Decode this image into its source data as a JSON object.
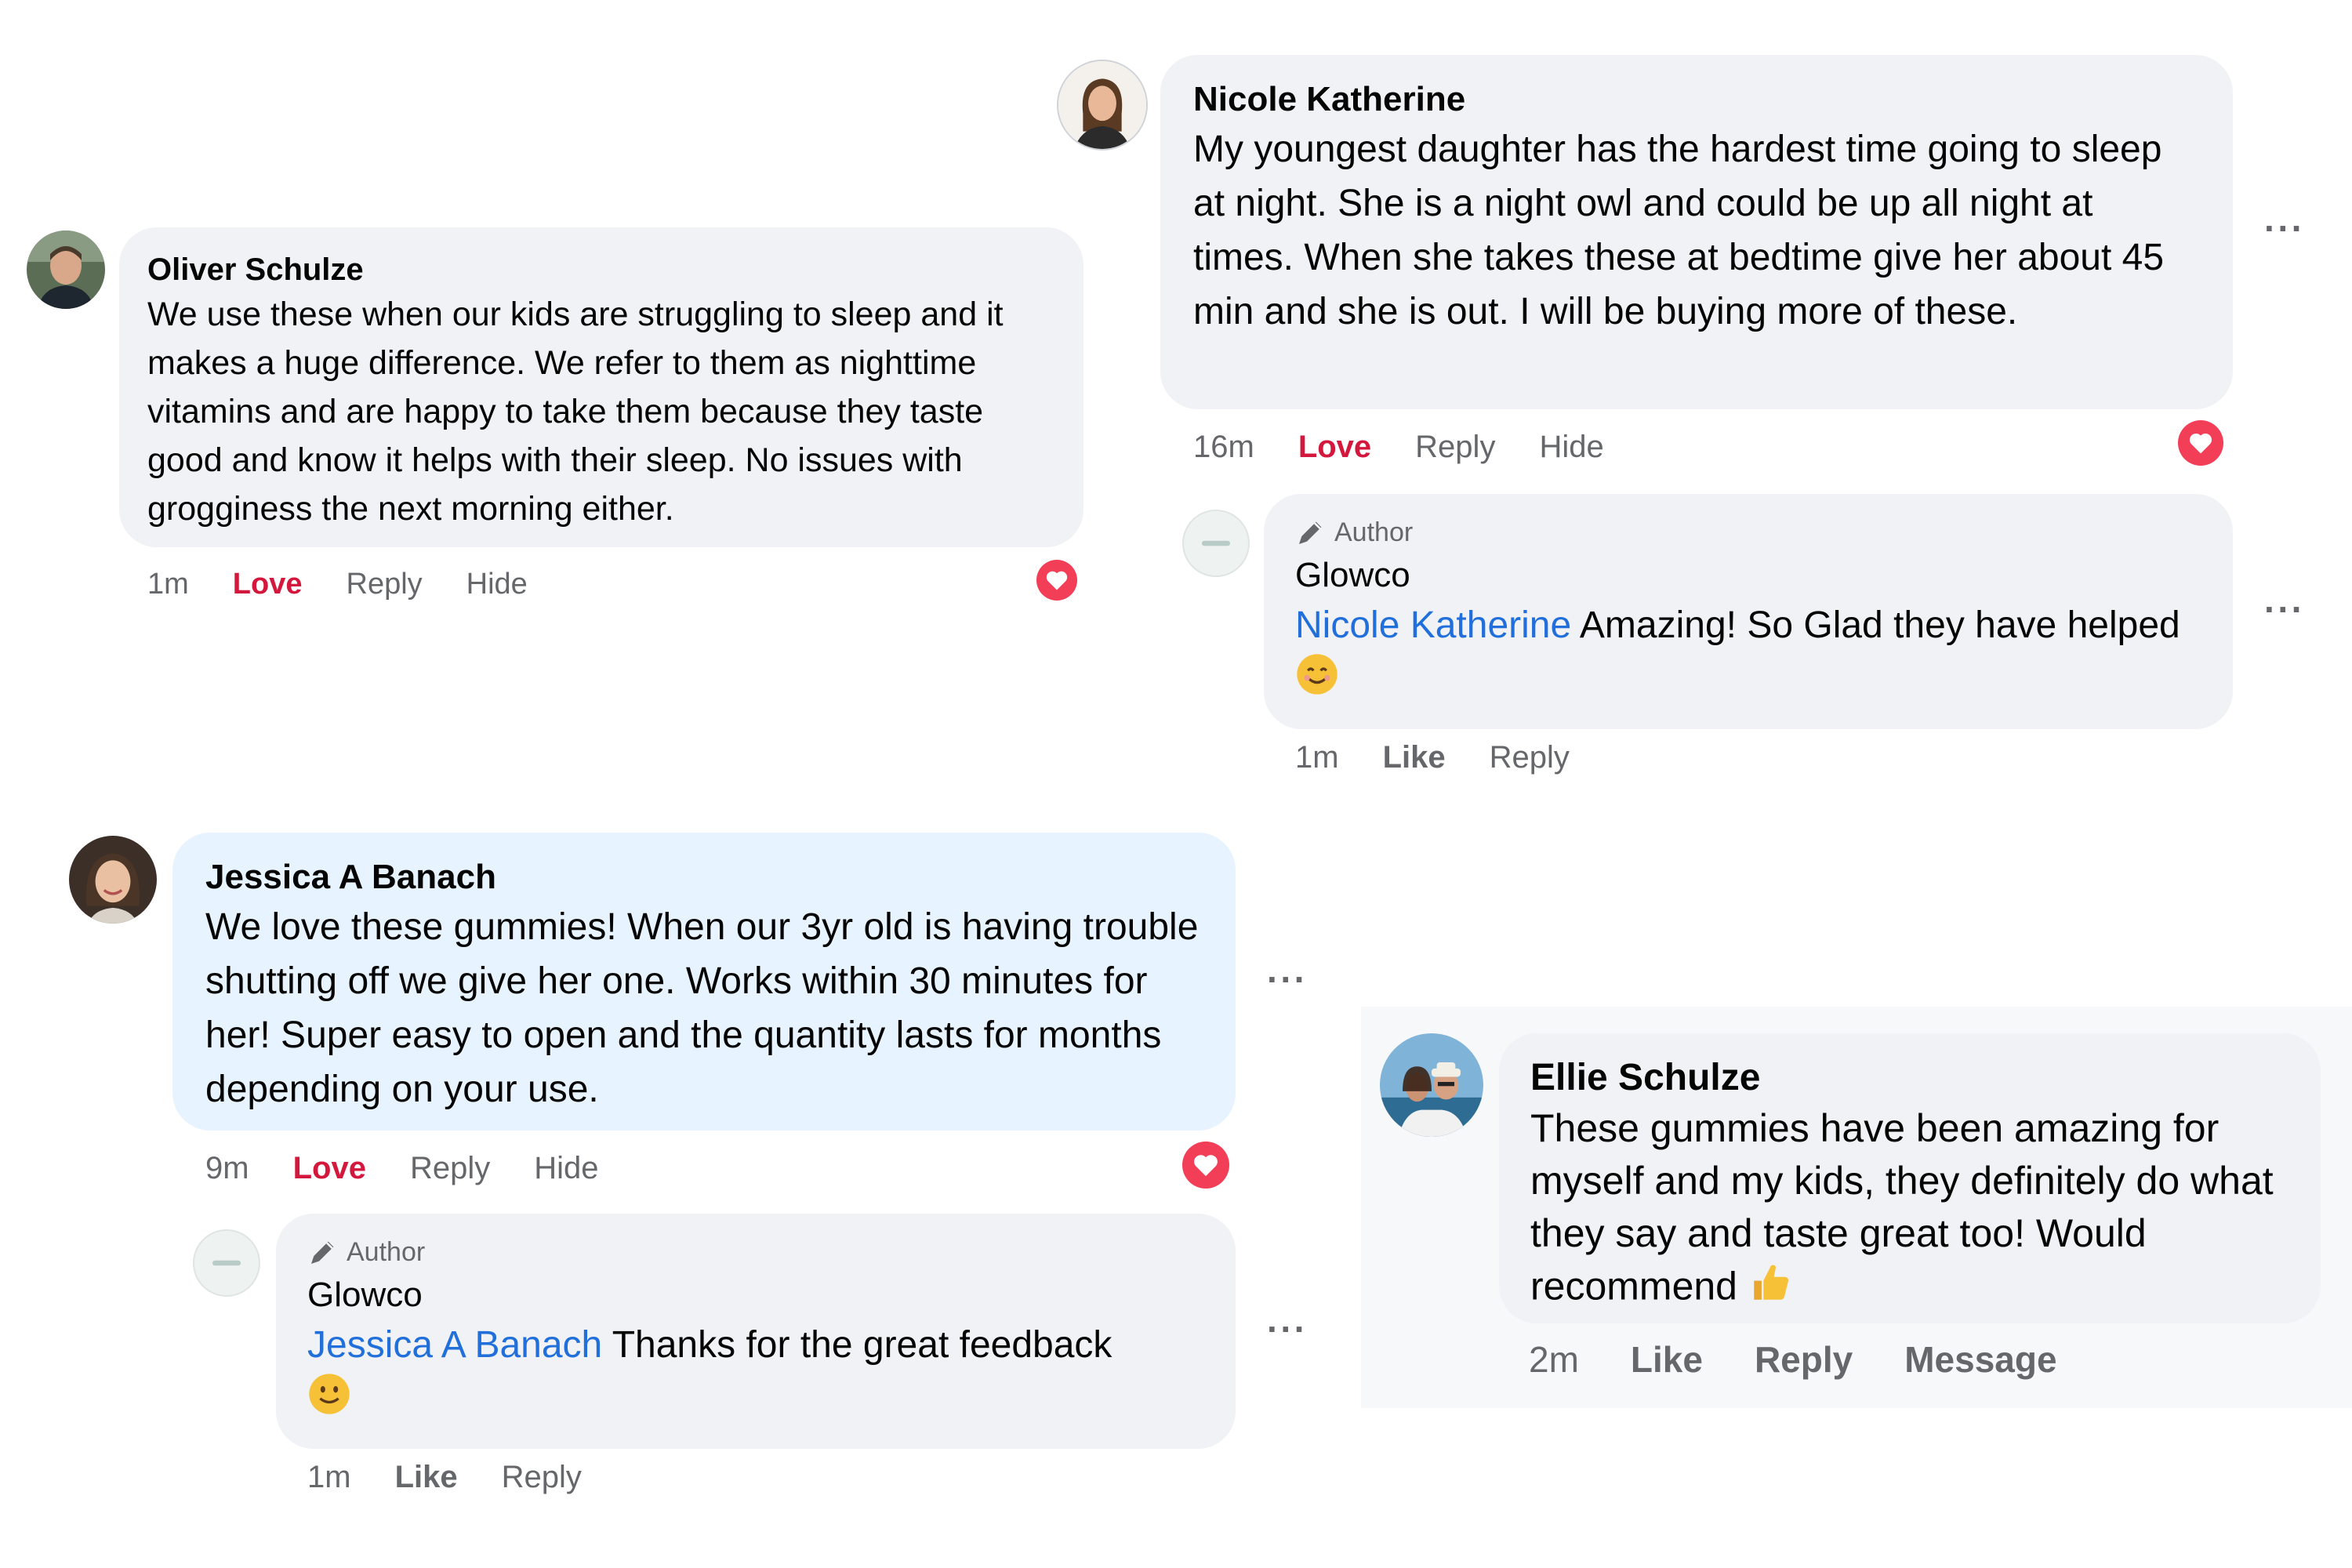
{
  "comments": {
    "oliver": {
      "name": "Oliver Schulze",
      "text": "We use these when our kids are struggling to sleep and it makes a huge difference. We refer to them as nighttime vitamins and are happy to take them because they taste good and know it helps with their sleep. No issues with grogginess the next morning either.",
      "time": "1m",
      "action_love": "Love",
      "action_reply": "Reply",
      "action_hide": "Hide",
      "reaction": "love"
    },
    "nicole": {
      "name": "Nicole Katherine",
      "text": "My youngest daughter has the hardest time going to sleep at night. She is a night owl and could be up all night at times. When she takes these at bedtime give her about 45 min and she is out. I will be buying more of these.",
      "time": "16m",
      "action_love": "Love",
      "action_reply": "Reply",
      "action_hide": "Hide",
      "more": "···",
      "reaction": "love",
      "reply": {
        "badge": "Author",
        "name": "Glowco",
        "mention": "Nicole Katherine",
        "text": "Amazing! So Glad they have helped",
        "emoji": "smiling-face",
        "time": "1m",
        "action_like": "Like",
        "action_reply": "Reply",
        "more": "···"
      }
    },
    "jessica": {
      "name": "Jessica A Banach",
      "text": "We love these gummies! When our 3yr old is having trouble shutting off we give her one. Works within 30 minutes for her! Super easy to open and the quantity lasts for months depending on your use.",
      "time": "9m",
      "action_love": "Love",
      "action_reply": "Reply",
      "action_hide": "Hide",
      "more": "···",
      "reaction": "love",
      "reply": {
        "badge": "Author",
        "name": "Glowco",
        "mention": "Jessica A Banach",
        "text": "Thanks for the great feedback",
        "emoji": "slightly-smiling-face",
        "time": "1m",
        "action_like": "Like",
        "action_reply": "Reply",
        "more": "···"
      }
    },
    "ellie": {
      "name": "Ellie Schulze",
      "text": "These gummies have been amazing for myself and my kids, they definitely do what they say and taste great too! Would recommend",
      "emoji": "thumbs-up",
      "time": "2m",
      "action_like": "Like",
      "action_reply": "Reply",
      "action_message": "Message"
    }
  },
  "colors": {
    "bubble": "#f0f2f5",
    "bubble_highlight": "#e7f3ff",
    "love_red": "#d4183d",
    "mention_blue": "#216fdb",
    "muted": "#65676b"
  }
}
